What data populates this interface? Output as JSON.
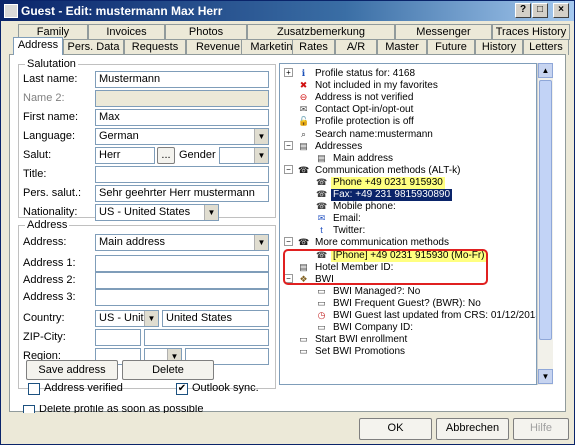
{
  "window": {
    "title": "Guest - Edit: mustermann Max Herr"
  },
  "tabs_row1": [
    "Family",
    "Invoices",
    "Photos",
    "Zusatzbemerkung",
    "Messenger",
    "Traces History"
  ],
  "tabs_row2": [
    "Address",
    "Pers. Data",
    "Requests",
    "Revenue",
    "Marketing",
    "Rates",
    "A/R",
    "Master",
    "Future",
    "History",
    "Letters"
  ],
  "salutation": {
    "legend": "Salutation",
    "last_name_label": "Last name:",
    "last_name": "Mustermann",
    "name2_label": "Name 2:",
    "name2": "",
    "first_name_label": "First name:",
    "first_name": "Max",
    "language_label": "Language:",
    "language": "German",
    "salut_label": "Salut:",
    "salut": "Herr",
    "salut_btn": "...",
    "gender_label": "Gender",
    "gender": "",
    "title_label": "Title:",
    "title": "",
    "pers_salut_label": "Pers. salut.:",
    "pers_salut": "Sehr geehrter Herr mustermann",
    "nationality_label": "Nationality:",
    "nationality": "US - United States"
  },
  "address": {
    "legend": "Address",
    "address_label": "Address:",
    "address": "Main address",
    "address1_label": "Address 1:",
    "address2_label": "Address 2:",
    "address3_label": "Address 3:",
    "country_label": "Country:",
    "country_code": "US - United",
    "country_name": "United States",
    "zip_label": "ZIP-City:",
    "region_label": "Region:",
    "save_btn": "Save address",
    "delete_btn": "Delete",
    "verified_label": "Address verified",
    "outlook_label": "Outlook sync."
  },
  "bottom_cut_label": "Delete profile as soon as possible",
  "tree": [
    {
      "text": "Profile status for: 4168",
      "icon": "info-icon",
      "glyph": "ℹ",
      "color": "#1a4fb8",
      "hl": ""
    },
    {
      "text": "Not included in my favorites",
      "icon": "red-x-icon",
      "glyph": "✖",
      "color": "#d01010",
      "hl": ""
    },
    {
      "text": "Address is not verified",
      "icon": "red-minus-icon",
      "glyph": "⊖",
      "color": "#d01010",
      "hl": ""
    },
    {
      "text": "Contact Opt-in/opt-out",
      "icon": "contact-icon",
      "glyph": "✉",
      "color": "#404040",
      "hl": ""
    },
    {
      "text": "Profile protection is off",
      "icon": "lock-icon",
      "glyph": "🔓",
      "color": "#404040",
      "hl": ""
    },
    {
      "text": "Search name:mustermann",
      "icon": "search-icon",
      "glyph": "⌕",
      "color": "#404040",
      "hl": ""
    },
    {
      "text": "Addresses",
      "icon": "folder-icon",
      "glyph": "▤",
      "color": "#404040",
      "hl": ""
    },
    {
      "text": "Main address",
      "icon": "address-icon",
      "glyph": "▤",
      "color": "#404040",
      "hl": ""
    },
    {
      "text": "Communication methods (ALT-k)",
      "icon": "phone-group-icon",
      "glyph": "☎",
      "color": "#202020",
      "hl": ""
    },
    {
      "text": "Phone +49 0231 915930",
      "icon": "phone-icon",
      "glyph": "☎",
      "color": "#404040",
      "hl": "yellow"
    },
    {
      "text": "Fax: +49 231 9815930890",
      "icon": "fax-icon",
      "glyph": "☎",
      "color": "#404040",
      "hl": "navy"
    },
    {
      "text": "Mobile phone:",
      "icon": "mobile-icon",
      "glyph": "☎",
      "color": "#404040",
      "hl": ""
    },
    {
      "text": "Email:",
      "icon": "email-icon",
      "glyph": "✉",
      "color": "#2050c0",
      "hl": ""
    },
    {
      "text": "Twitter:",
      "icon": "twitter-icon",
      "glyph": "t",
      "color": "#2050c0",
      "hl": ""
    },
    {
      "text": "More communication methods",
      "icon": "phone-group-icon",
      "glyph": "☎",
      "color": "#202020",
      "hl": ""
    },
    {
      "text": "[Phone] +49 0231 915930 (Mo-Fr)",
      "icon": "phone-icon",
      "glyph": "☎",
      "color": "#404040",
      "hl": "yellow"
    },
    {
      "text": "Hotel Member ID:",
      "icon": "member-icon",
      "glyph": "▤",
      "color": "#404040",
      "hl": ""
    },
    {
      "text": "BWI",
      "icon": "bwi-icon",
      "glyph": "❖",
      "color": "#806020",
      "hl": ""
    },
    {
      "text": "BWI Managed?: No",
      "icon": "doc-icon",
      "glyph": "▭",
      "color": "#404040",
      "hl": ""
    },
    {
      "text": "BWI Frequent Guest? (BWR): No",
      "icon": "doc-icon",
      "glyph": "▭",
      "color": "#404040",
      "hl": ""
    },
    {
      "text": "BWI Guest last updated from CRS: 01/12/2013",
      "icon": "clock-icon",
      "glyph": "◷",
      "color": "#c02020",
      "hl": ""
    },
    {
      "text": "BWI Company ID:",
      "icon": "doc-icon",
      "glyph": "▭",
      "color": "#404040",
      "hl": ""
    },
    {
      "text": "Start BWI enrollment",
      "icon": "start-icon",
      "glyph": "▭",
      "color": "#404040",
      "hl": ""
    },
    {
      "text": "Set BWI Promotions",
      "icon": "promo-icon",
      "glyph": "▭",
      "color": "#404040",
      "hl": ""
    }
  ],
  "buttons": {
    "ok": "OK",
    "cancel": "Abbrechen",
    "help": "Hilfe"
  }
}
